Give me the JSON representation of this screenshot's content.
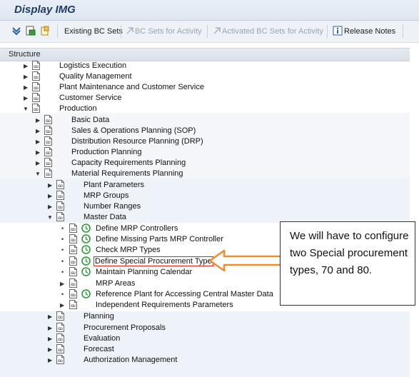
{
  "window": {
    "title": "Display IMG"
  },
  "toolbar": {
    "existing_bc_sets": "Existing BC Sets",
    "bc_sets_for_activity": "BC Sets for Activity",
    "activated_bc_sets_for_activity": "Activated BC Sets for Activity",
    "release_notes": "Release Notes"
  },
  "structure": {
    "header": "Structure"
  },
  "tree": {
    "logistics_execution": "Logistics Execution",
    "quality_management": "Quality Management",
    "plant_maintenance": "Plant Maintenance and Customer Service",
    "customer_service": "Customer Service",
    "production": "Production",
    "basic_data": "Basic Data",
    "sop": "Sales & Operations Planning (SOP)",
    "drp": "Distribution Resource Planning (DRP)",
    "production_planning": "Production Planning",
    "capacity_requirements_planning": "Capacity Requirements Planning",
    "material_requirements_planning": "Material Requirements Planning",
    "plant_parameters": "Plant Parameters",
    "mrp_groups": "MRP Groups",
    "number_ranges": "Number Ranges",
    "master_data": "Master Data",
    "define_mrp_controllers": "Define MRP Controllers",
    "define_missing_parts_mrp_controller": "Define Missing Parts MRP Controller",
    "check_mrp_types": "Check MRP Types",
    "define_special_procurement_type": "Define Special Procurement Type",
    "maintain_planning_calendar": "Maintain Planning Calendar",
    "mrp_areas": "MRP Areas",
    "reference_plant": "Reference Plant for Accessing Central Master Data",
    "independent_requirements_parameters": "Independent Requirements Parameters",
    "planning": "Planning",
    "procurement_proposals": "Procurement Proposals",
    "evaluation": "Evaluation",
    "forecast": "Forecast",
    "authorization_management": "Authorization Management"
  },
  "callout": {
    "text": "We will have to configure two Special procurement types, 70 and 80."
  },
  "colors": {
    "highlight_box": "#e0261c",
    "callout_arrow": "#f28b30",
    "title": "#1f3d64"
  }
}
